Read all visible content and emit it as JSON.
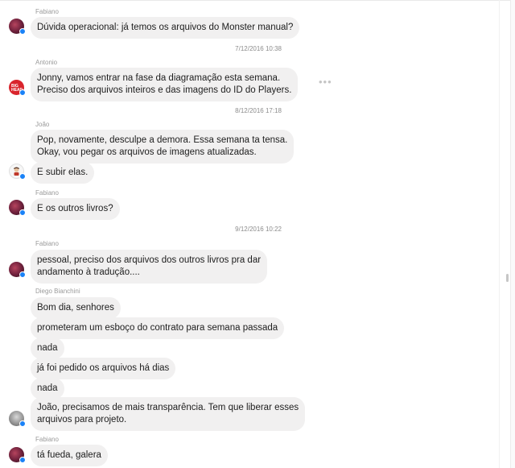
{
  "chat": {
    "groups": [
      {
        "sender": "Fabiano",
        "avatar": "fabiano-avatar",
        "messages": [
          "Dúvida operacional: já temos os arquivos do Monster manual?"
        ]
      },
      {
        "timestamp": "7/12/2016 10:38",
        "sender": "Antonio",
        "avatar": "antonio-avatar",
        "messages": [
          "Jonny, vamos entrar na fase da diagramação esta semana.\nPreciso dos arquivos inteiros e das imagens do ID do Players."
        ]
      },
      {
        "timestamp": "8/12/2016 17:18",
        "sender": "João",
        "avatar": "joao-avatar",
        "messages": [
          "Pop, novamente, desculpe a demora. Essa semana ta tensa.\nOkay, vou pegar os arquivos de imagens atualizadas.",
          "E subir elas."
        ]
      },
      {
        "sender": "Fabiano",
        "avatar": "fabiano-avatar",
        "messages": [
          "E os outros livros?"
        ]
      },
      {
        "timestamp": "9/12/2016 10:22",
        "sender": "Fabiano",
        "avatar": "fabiano-avatar",
        "messages": [
          "pessoal, preciso dos arquivos dos outros livros pra dar\nandamento à tradução...."
        ]
      },
      {
        "sender": "Diego Bianchini",
        "avatar": "diego-avatar",
        "messages": [
          "Bom dia, senhores",
          "prometeram um esboço do contrato para semana passada",
          "nada",
          "já foi pedido os arquivos há dias",
          "nada",
          "João, precisamos de mais transparência. Tem que liberar esses\narquivos para projeto."
        ]
      },
      {
        "sender": "Fabiano",
        "avatar": "fabiano-avatar",
        "messages": [
          "tá fueda, galera"
        ]
      }
    ],
    "more_icon": "more-options-icon",
    "antonio_logo": "BIG\nHEAD",
    "colors": {
      "bubble": "#f1f0f0",
      "badge": "#1a82f7",
      "antonio_avatar": "#d9242c"
    }
  }
}
